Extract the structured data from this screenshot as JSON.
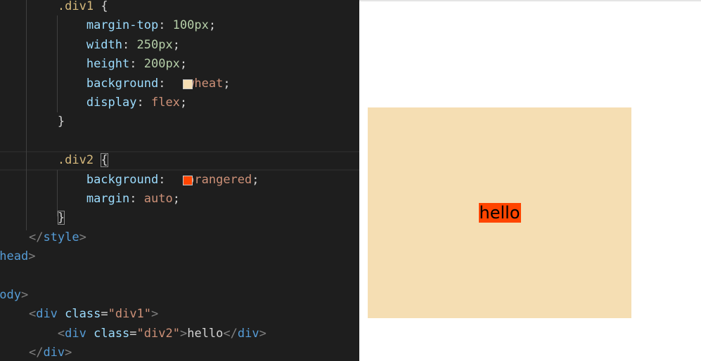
{
  "editor": {
    "lines": [
      [
        {
          "t": "        ",
          "c": "pun"
        },
        {
          "t": ".div1",
          "c": "sel"
        },
        {
          "t": " {",
          "c": "pun"
        }
      ],
      [
        {
          "t": "            ",
          "c": "pun"
        },
        {
          "t": "margin-top",
          "c": "prop"
        },
        {
          "t": ": ",
          "c": "pun"
        },
        {
          "t": "100px",
          "c": "num"
        },
        {
          "t": ";",
          "c": "pun"
        }
      ],
      [
        {
          "t": "            ",
          "c": "pun"
        },
        {
          "t": "width",
          "c": "prop"
        },
        {
          "t": ": ",
          "c": "pun"
        },
        {
          "t": "250px",
          "c": "num"
        },
        {
          "t": ";",
          "c": "pun"
        }
      ],
      [
        {
          "t": "            ",
          "c": "pun"
        },
        {
          "t": "height",
          "c": "prop"
        },
        {
          "t": ": ",
          "c": "pun"
        },
        {
          "t": "200px",
          "c": "num"
        },
        {
          "t": ";",
          "c": "pun"
        }
      ],
      [
        {
          "t": "            ",
          "c": "pun"
        },
        {
          "t": "background",
          "c": "prop"
        },
        {
          "t": ":   ",
          "c": "pun"
        },
        {
          "t": "wheat",
          "c": "str"
        },
        {
          "t": ";",
          "c": "pun"
        }
      ],
      [
        {
          "t": "            ",
          "c": "pun"
        },
        {
          "t": "display",
          "c": "prop"
        },
        {
          "t": ": ",
          "c": "pun"
        },
        {
          "t": "flex",
          "c": "str"
        },
        {
          "t": ";",
          "c": "pun"
        }
      ],
      [
        {
          "t": "        ",
          "c": "pun"
        },
        {
          "t": "}",
          "c": "pun"
        }
      ],
      [],
      [
        {
          "t": "        ",
          "c": "pun"
        },
        {
          "t": ".div2",
          "c": "sel"
        },
        {
          "t": " ",
          "c": "pun"
        },
        {
          "t": "{",
          "c": "pun",
          "m": true
        }
      ],
      [
        {
          "t": "            ",
          "c": "pun"
        },
        {
          "t": "background",
          "c": "prop"
        },
        {
          "t": ":   ",
          "c": "pun"
        },
        {
          "t": "orangered",
          "c": "str"
        },
        {
          "t": ";",
          "c": "pun"
        }
      ],
      [
        {
          "t": "            ",
          "c": "pun"
        },
        {
          "t": "margin",
          "c": "prop"
        },
        {
          "t": ": ",
          "c": "pun"
        },
        {
          "t": "auto",
          "c": "str"
        },
        {
          "t": ";",
          "c": "pun"
        }
      ],
      [
        {
          "t": "        ",
          "c": "pun"
        },
        {
          "t": "}",
          "c": "pun",
          "m": true
        }
      ],
      [
        {
          "t": "    ",
          "c": "pun"
        },
        {
          "t": "</",
          "c": "angle"
        },
        {
          "t": "style",
          "c": "tag"
        },
        {
          "t": ">",
          "c": "angle"
        }
      ],
      [
        {
          "t": "/",
          "c": "angle"
        },
        {
          "t": "head",
          "c": "tag"
        },
        {
          "t": ">",
          "c": "angle"
        }
      ],
      [],
      [
        {
          "t": "body",
          "c": "tag"
        },
        {
          "t": ">",
          "c": "angle"
        }
      ],
      [
        {
          "t": "    ",
          "c": "pun"
        },
        {
          "t": "<",
          "c": "angle"
        },
        {
          "t": "div",
          "c": "tag"
        },
        {
          "t": " ",
          "c": "pun"
        },
        {
          "t": "class",
          "c": "attr"
        },
        {
          "t": "=",
          "c": "pun"
        },
        {
          "t": "\"div1\"",
          "c": "str"
        },
        {
          "t": ">",
          "c": "angle"
        }
      ],
      [
        {
          "t": "        ",
          "c": "pun"
        },
        {
          "t": "<",
          "c": "angle"
        },
        {
          "t": "div",
          "c": "tag"
        },
        {
          "t": " ",
          "c": "pun"
        },
        {
          "t": "class",
          "c": "attr"
        },
        {
          "t": "=",
          "c": "pun"
        },
        {
          "t": "\"div2\"",
          "c": "str"
        },
        {
          "t": ">",
          "c": "angle"
        },
        {
          "t": "hello",
          "c": "text"
        },
        {
          "t": "</",
          "c": "angle"
        },
        {
          "t": "div",
          "c": "tag"
        },
        {
          "t": ">",
          "c": "angle"
        }
      ],
      [
        {
          "t": "    ",
          "c": "pun"
        },
        {
          "t": "</",
          "c": "angle"
        },
        {
          "t": "div",
          "c": "tag"
        },
        {
          "t": ">",
          "c": "angle"
        }
      ]
    ],
    "color_swatches": [
      {
        "line": 4,
        "color": "#f5deb3"
      },
      {
        "line": 9,
        "color": "#ff4500"
      }
    ]
  },
  "preview": {
    "div1_background": "#f5deb3",
    "div2_background": "#ff4500",
    "div2_text": "hello"
  }
}
